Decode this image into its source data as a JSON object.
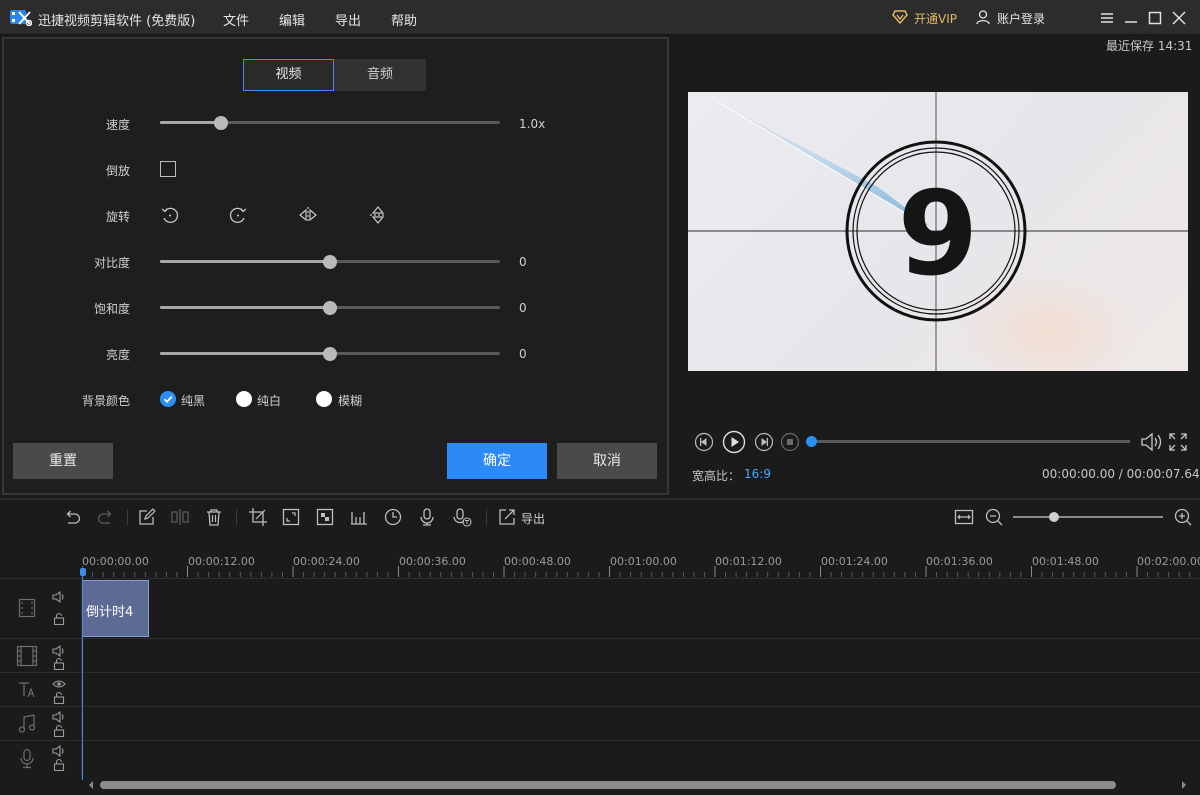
{
  "app": {
    "title": "迅捷视频剪辑软件 (免费版)",
    "menu": [
      "文件",
      "编辑",
      "导出",
      "帮助"
    ],
    "vip_label": "开通VIP",
    "login_label": "账户登录",
    "accent": "#2c8af8"
  },
  "props": {
    "tabs": [
      "视频",
      "音频"
    ],
    "speed": {
      "label": "速度",
      "value": "1.0x",
      "level": 0.18
    },
    "reverse": {
      "label": "倒放",
      "checked": false
    },
    "rotate": {
      "label": "旋转"
    },
    "contrast": {
      "label": "对比度",
      "value": "0",
      "level": 0.5
    },
    "saturation": {
      "label": "饱和度",
      "value": "0",
      "level": 0.5
    },
    "brightness": {
      "label": "亮度",
      "value": "0",
      "level": 0.5
    },
    "background": {
      "label": "背景颜色",
      "options": [
        "纯黑",
        "纯白",
        "模糊"
      ],
      "selected": "纯黑"
    },
    "reset_label": "重置",
    "confirm_label": "确定",
    "cancel_label": "取消"
  },
  "preview": {
    "last_saved": "最近保存 14:31",
    "countdown_digit": "9",
    "aspect_label": "宽高比：",
    "aspect_value": "16:9",
    "time_readout": "00:00:00.00 / 00:00:07.64",
    "progress": 0
  },
  "timeline": {
    "export_label": "导出",
    "ruler": [
      "00:00:00.00",
      "00:00:12.00",
      "00:00:24.00",
      "00:00:36.00",
      "00:00:48.00",
      "00:01:00.00",
      "00:01:12.00",
      "00:01:24.00",
      "00:01:36.00",
      "00:01:48.00",
      "00:02:00.00"
    ],
    "clip_label": "倒计时4",
    "zoom_level": 0.27
  }
}
